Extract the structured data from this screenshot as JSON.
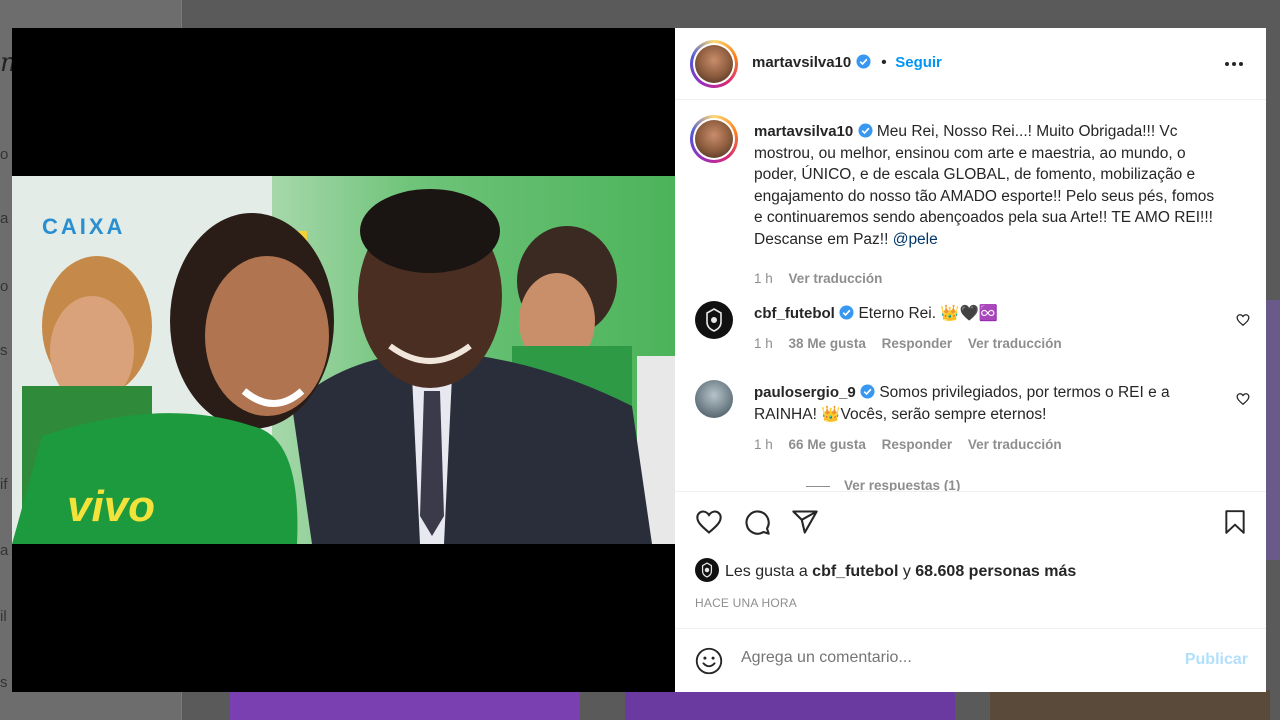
{
  "background": {
    "sidebar_fragments": [
      "o",
      "a",
      "o",
      "s",
      "if",
      "a",
      "il",
      "s"
    ]
  },
  "post": {
    "username": "martavsilva10",
    "follow_label": "Seguir",
    "dot": "•",
    "caption": "Meu Rei, Nosso Rei...! Muito Obrigada!!! Vc mostrou, ou melhor, ensinou com arte e maestria, ao mundo, o poder, ÚNICO, e de escala GLOBAL, de fomento, mobilização e engajamento do nosso tão AMADO esporte!! Pelo seus pés, fomos e continuaremos sendo abençoados pela sua Arte!! TE AMO REI!!! Descanse em Paz!! ",
    "caption_mention": "@pele",
    "caption_time": "1 h",
    "caption_translate": "Ver traducción",
    "photo_text": {
      "left_sign": "CAIXA",
      "jersey_text": "vivo"
    }
  },
  "comments": [
    {
      "username": "cbf_futebol",
      "text": "Eterno Rei. 👑🖤♾️",
      "time": "1 h",
      "likes": "38 Me gusta",
      "reply": "Responder",
      "translate": "Ver traducción"
    },
    {
      "username": "paulosergio_9",
      "text": "Somos privilegiados, por termos o REI e a RAINHA! 👑Vocês, serão sempre eternos!",
      "time": "1 h",
      "likes": "66 Me gusta",
      "reply": "Responder",
      "translate": "Ver traducción",
      "view_replies": "Ver respuestas (1)"
    }
  ],
  "likes": {
    "prefix": "Les gusta a ",
    "user": "cbf_futebol",
    "middle": " y ",
    "others": "68.608 personas más"
  },
  "timestamp": "HACE UNA HORA",
  "comment_box": {
    "placeholder": "Agrega un comentario...",
    "publish_label": "Publicar"
  },
  "colors": {
    "accent": "#0095f6",
    "publish_disabled": "#b2dffc",
    "verified": "#3897f0"
  }
}
